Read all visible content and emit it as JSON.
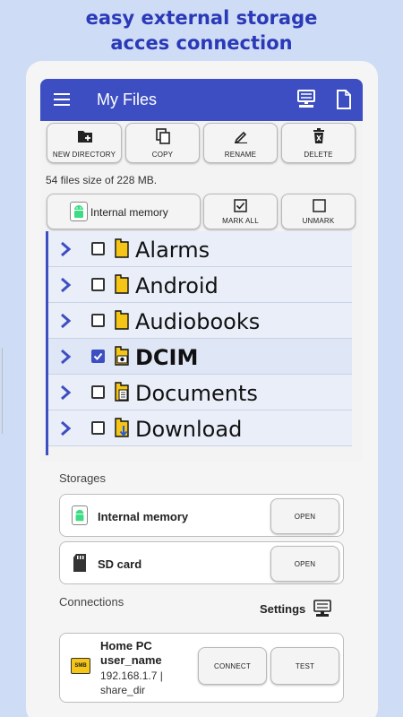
{
  "promo": {
    "line1": "easy external storage",
    "line2": "acces connection"
  },
  "appbar": {
    "title": "My Files",
    "menu_icon": "hamburger-menu-icon",
    "icons": [
      "computer-icon",
      "file-icon"
    ]
  },
  "toolbar": {
    "new_directory": "NEW DIRECTORY",
    "copy": "COPY",
    "rename": "RENAME",
    "delete": "DELETE"
  },
  "info": "54 files size of 228 MB.",
  "selector": {
    "storage": "Internal memory",
    "mark_all": "MARK ALL",
    "unmark": "UNMARK"
  },
  "files": [
    {
      "name": "Alarms",
      "checked": false,
      "icon": "folder-icon"
    },
    {
      "name": "Android",
      "checked": false,
      "icon": "folder-icon"
    },
    {
      "name": "Audiobooks",
      "checked": false,
      "icon": "folder-icon"
    },
    {
      "name": "DCIM",
      "checked": true,
      "icon": "folder-camera-icon"
    },
    {
      "name": "Documents",
      "checked": false,
      "icon": "folder-document-icon"
    },
    {
      "name": "Download",
      "checked": false,
      "icon": "folder-download-icon"
    }
  ],
  "storages": {
    "heading": "Storages",
    "items": [
      {
        "label": "Internal memory",
        "button": "OPEN",
        "icon": "android-icon"
      },
      {
        "label": "SD card",
        "button": "OPEN",
        "icon": "sd-card-icon"
      }
    ]
  },
  "connections": {
    "heading": "Connections",
    "settings": "Settings",
    "settings_icon": "computer-settings-icon",
    "item": {
      "name": "Home PC",
      "user": "user_name",
      "address": "192.168.1.7 |",
      "share": "share_dir",
      "icon": "smb-icon",
      "icon_text": "SMB",
      "connect": "CONNECT",
      "test": "TEST"
    }
  },
  "colors": {
    "primary": "#3d4ec2",
    "folder": "#f5c518",
    "background": "#cfdcf5"
  }
}
